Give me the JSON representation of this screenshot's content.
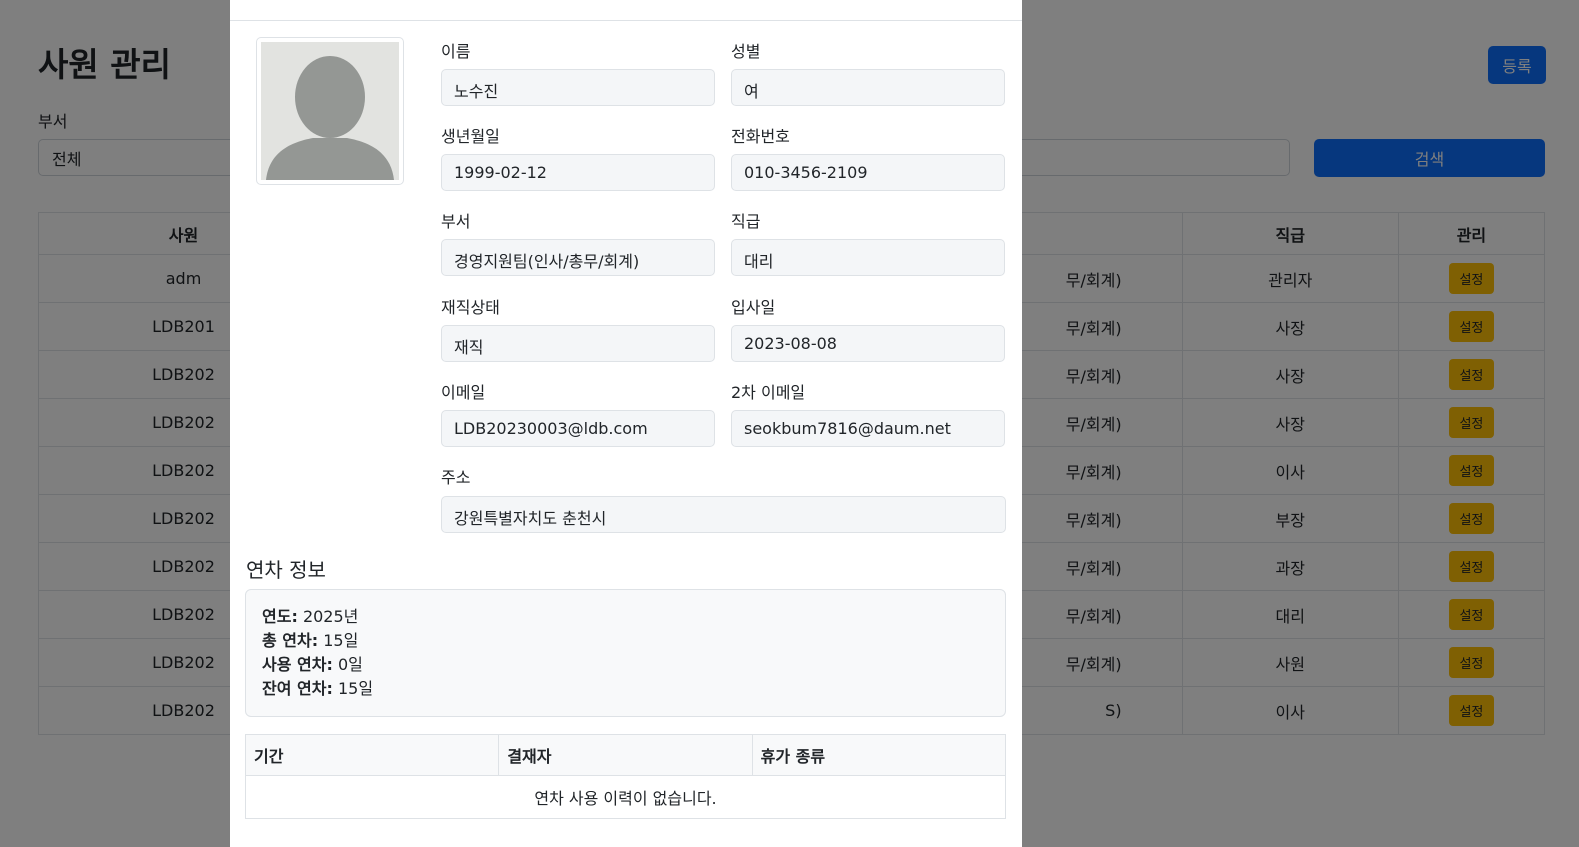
{
  "page": {
    "title": "사원 관리",
    "register_label": "등록",
    "dept_filter_label": "부서",
    "dept_filter_value": "전체",
    "search_label": "검색",
    "table": {
      "headers": [
        "사원",
        "",
        "직급",
        "관리"
      ],
      "rows": [
        {
          "id": "adm",
          "dept": "무/회계)",
          "rank": "관리자",
          "action": "설정"
        },
        {
          "id": "LDB201",
          "dept": "무/회계)",
          "rank": "사장",
          "action": "설정"
        },
        {
          "id": "LDB202",
          "dept": "무/회계)",
          "rank": "사장",
          "action": "설정"
        },
        {
          "id": "LDB202",
          "dept": "무/회계)",
          "rank": "사장",
          "action": "설정"
        },
        {
          "id": "LDB202",
          "dept": "무/회계)",
          "rank": "이사",
          "action": "설정"
        },
        {
          "id": "LDB202",
          "dept": "무/회계)",
          "rank": "부장",
          "action": "설정"
        },
        {
          "id": "LDB202",
          "dept": "무/회계)",
          "rank": "과장",
          "action": "설정"
        },
        {
          "id": "LDB202",
          "dept": "무/회계)",
          "rank": "대리",
          "action": "설정"
        },
        {
          "id": "LDB202",
          "dept": "무/회계)",
          "rank": "사원",
          "action": "설정"
        },
        {
          "id": "LDB202",
          "dept": "S)",
          "rank": "이사",
          "action": "설정"
        }
      ]
    }
  },
  "modal": {
    "fields": {
      "name": {
        "label": "이름",
        "value": "노수진"
      },
      "gender": {
        "label": "성별",
        "value": "여"
      },
      "birth": {
        "label": "생년월일",
        "value": "1999-02-12"
      },
      "phone": {
        "label": "전화번호",
        "value": "010-3456-2109"
      },
      "dept": {
        "label": "부서",
        "value": "경영지원팀(인사/총무/회계)"
      },
      "rank": {
        "label": "직급",
        "value": "대리"
      },
      "status": {
        "label": "재직상태",
        "value": "재직"
      },
      "hire_date": {
        "label": "입사일",
        "value": "2023-08-08"
      },
      "email": {
        "label": "이메일",
        "value": "LDB20230003@ldb.com"
      },
      "email2": {
        "label": "2차 이메일",
        "value": "seokbum7816@daum.net"
      },
      "address": {
        "label": "주소",
        "value": "강원특별자치도 춘천시"
      }
    },
    "leave": {
      "section_title": "연차 정보",
      "year_label": "연도:",
      "year_value": "2025년",
      "total_label": "총 연차:",
      "total_value": "15일",
      "used_label": "사용 연차:",
      "used_value": "0일",
      "remaining_label": "잔여 연차:",
      "remaining_value": "15일"
    },
    "history": {
      "headers": [
        "기간",
        "결재자",
        "휴가 종류"
      ],
      "empty_message": "연차 사용 이력이 없습니다."
    }
  },
  "colors": {
    "primary": "#0d6efd",
    "warning": "#ffc107",
    "backdrop": "rgba(0,0,0,0.5)"
  }
}
